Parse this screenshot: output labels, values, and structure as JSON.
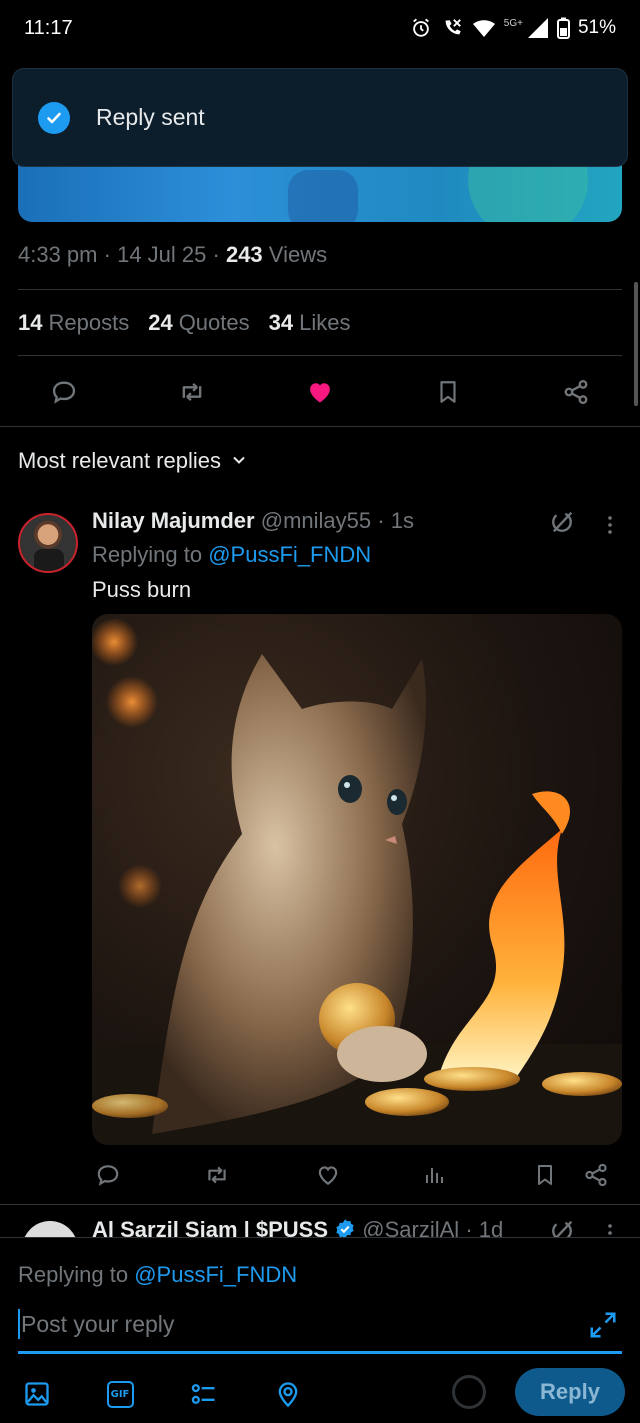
{
  "status_bar": {
    "time": "11:17",
    "network": "5G+",
    "battery": "51%"
  },
  "toast": {
    "message": "Reply sent",
    "icon": "check-circle-icon"
  },
  "tweet_meta": {
    "time": "4:33 pm",
    "date": "14 Jul 25",
    "views_count": "243",
    "views_label": "Views"
  },
  "tweet_stats": {
    "reposts_count": "14",
    "reposts_label": "Reposts",
    "quotes_count": "24",
    "quotes_label": "Quotes",
    "likes_count": "34",
    "likes_label": "Likes"
  },
  "action_bar": {
    "icons": [
      "reply-icon",
      "repost-icon",
      "like-icon-filled",
      "bookmark-icon",
      "share-icon"
    ],
    "like_color": "#f91880"
  },
  "sort": {
    "label": "Most relevant replies"
  },
  "reply": {
    "name": "Nilay Majumder",
    "handle": "@mnilay55",
    "time": "1s",
    "replying_prefix": "Replying to",
    "replying_mention": "@PussFi_FNDN",
    "text": "Puss burn",
    "image_alt": "kitten with gold coin and flame"
  },
  "next_reply": {
    "name": "Al Sarzil Siam | $PUSS",
    "handle": "@SarzilAl",
    "time": "1d"
  },
  "composer": {
    "replying_prefix": "Replying to",
    "replying_mention": "@PussFi_FNDN",
    "placeholder": "Post your reply",
    "reply_button": "Reply"
  },
  "colors": {
    "accent": "#1d9bf0",
    "background": "#000000",
    "muted_text": "#71767b"
  }
}
